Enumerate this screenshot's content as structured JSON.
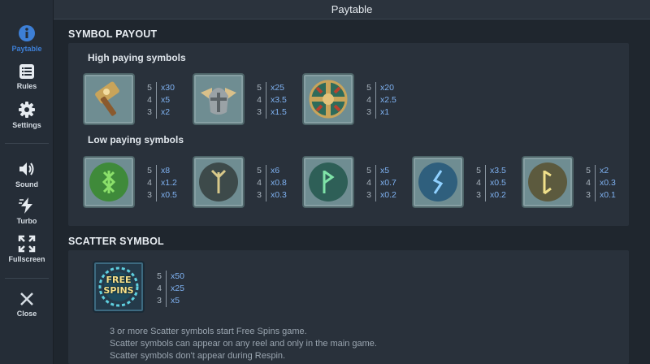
{
  "header": {
    "title": "Paytable"
  },
  "sidebar": {
    "items": [
      {
        "label": "Paytable",
        "icon": "info-icon"
      },
      {
        "label": "Rules",
        "icon": "list-icon"
      },
      {
        "label": "Settings",
        "icon": "gear-icon"
      },
      {
        "label": "Sound",
        "icon": "speaker-icon"
      },
      {
        "label": "Turbo",
        "icon": "turbo-icon"
      },
      {
        "label": "Fullscreen",
        "icon": "fullscreen-icon"
      },
      {
        "label": "Close",
        "icon": "close-icon"
      }
    ],
    "active_color": "#3d7fd6"
  },
  "symbol_payout": {
    "title": "SYMBOL PAYOUT",
    "high_title": "High paying symbols",
    "high": [
      {
        "name": "hammer",
        "pays": [
          [
            "5",
            "x30"
          ],
          [
            "4",
            "x5"
          ],
          [
            "3",
            "x2"
          ]
        ]
      },
      {
        "name": "helmet",
        "pays": [
          [
            "5",
            "x25"
          ],
          [
            "4",
            "x3.5"
          ],
          [
            "3",
            "x1.5"
          ]
        ]
      },
      {
        "name": "shield",
        "pays": [
          [
            "5",
            "x20"
          ],
          [
            "4",
            "x2.5"
          ],
          [
            "3",
            "x1"
          ]
        ]
      }
    ],
    "low_title": "Low paying symbols",
    "low": [
      {
        "name": "rune-green",
        "color": "#3f8a3a",
        "pays": [
          [
            "5",
            "x8"
          ],
          [
            "4",
            "x1.2"
          ],
          [
            "3",
            "x0.5"
          ]
        ]
      },
      {
        "name": "rune-dark",
        "color": "#3d4a4a",
        "pays": [
          [
            "5",
            "x6"
          ],
          [
            "4",
            "x0.8"
          ],
          [
            "3",
            "x0.3"
          ]
        ]
      },
      {
        "name": "rune-teal",
        "color": "#2e5f57",
        "pays": [
          [
            "5",
            "x5"
          ],
          [
            "4",
            "x0.7"
          ],
          [
            "3",
            "x0.2"
          ]
        ]
      },
      {
        "name": "rune-blue",
        "color": "#2f5f7d",
        "pays": [
          [
            "5",
            "x3.5"
          ],
          [
            "4",
            "x0.5"
          ],
          [
            "3",
            "x0.2"
          ]
        ]
      },
      {
        "name": "rune-olive",
        "color": "#5c5a3e",
        "pays": [
          [
            "5",
            "x2"
          ],
          [
            "4",
            "x0.3"
          ],
          [
            "3",
            "x0.1"
          ]
        ]
      }
    ]
  },
  "scatter": {
    "title": "SCATTER SYMBOL",
    "badge_line1": "FREE",
    "badge_line2": "SPINS",
    "pays": [
      [
        "5",
        "x50"
      ],
      [
        "4",
        "x25"
      ],
      [
        "3",
        "x5"
      ]
    ],
    "desc": [
      "3 or more Scatter symbols start Free Spins game.",
      "Scatter symbols can appear on any reel and only in the main game.",
      "Scatter symbols don't appear during Respin."
    ]
  }
}
